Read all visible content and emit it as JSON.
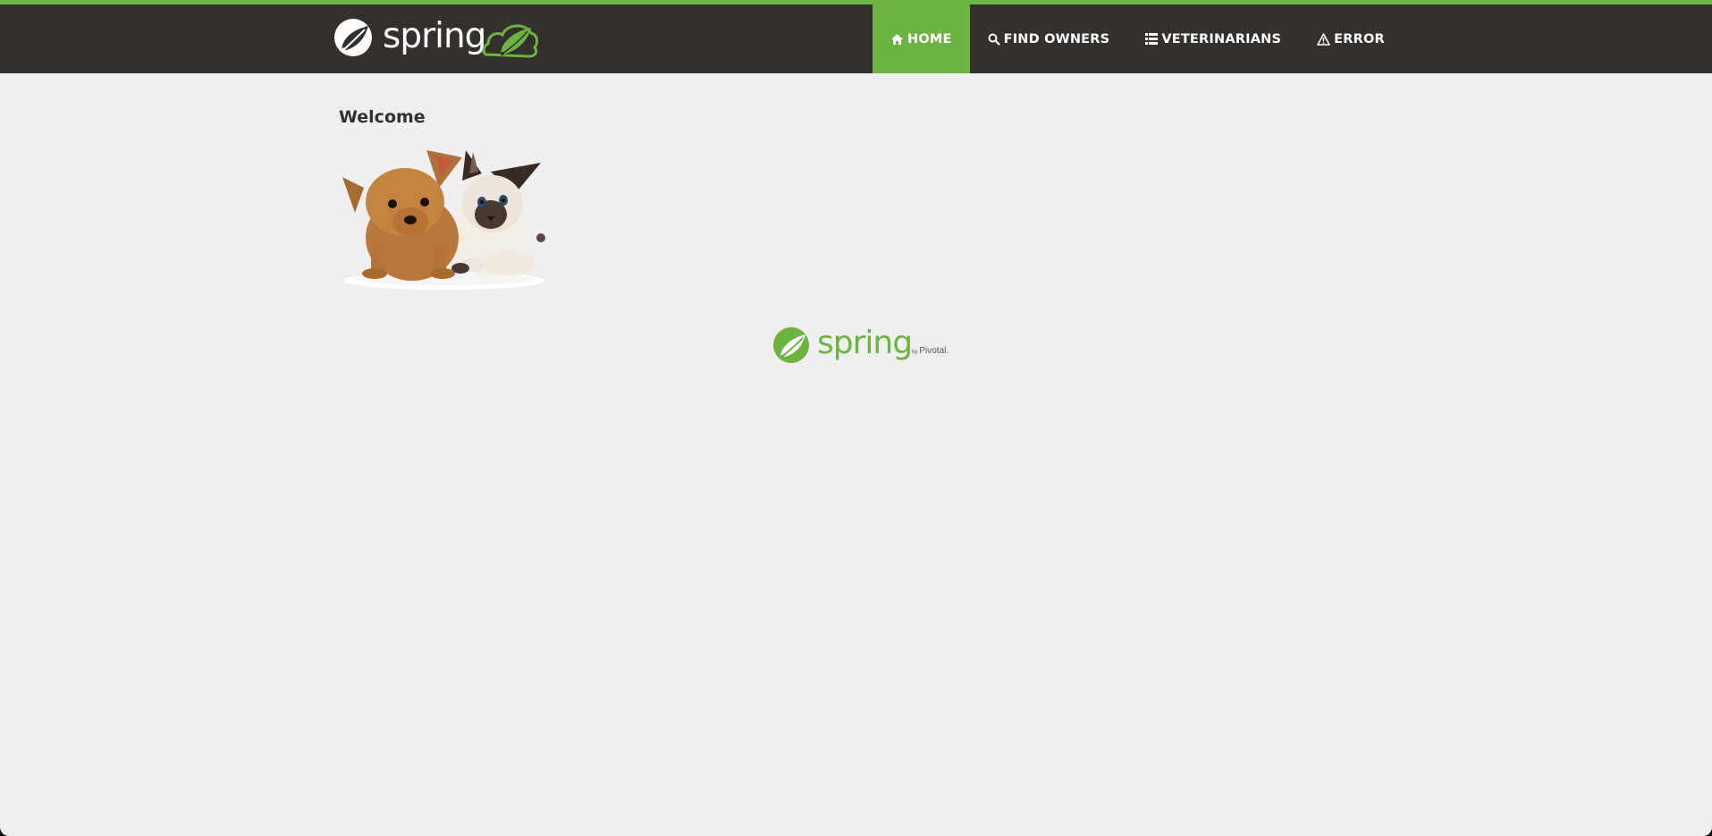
{
  "header": {
    "brand": "spring",
    "nav": [
      {
        "label": "HOME",
        "icon": "home-icon",
        "active": true
      },
      {
        "label": "FIND OWNERS",
        "icon": "search-icon",
        "active": false
      },
      {
        "label": "VETERINARIANS",
        "icon": "list-icon",
        "active": false
      },
      {
        "label": "ERROR",
        "icon": "warning-icon",
        "active": false
      }
    ]
  },
  "main": {
    "title": "Welcome"
  },
  "footer": {
    "brand": "spring",
    "by": "by",
    "company": "Pivotal."
  },
  "colors": {
    "accent": "#6db33f",
    "navbar": "#34302d",
    "background": "#efefef"
  }
}
